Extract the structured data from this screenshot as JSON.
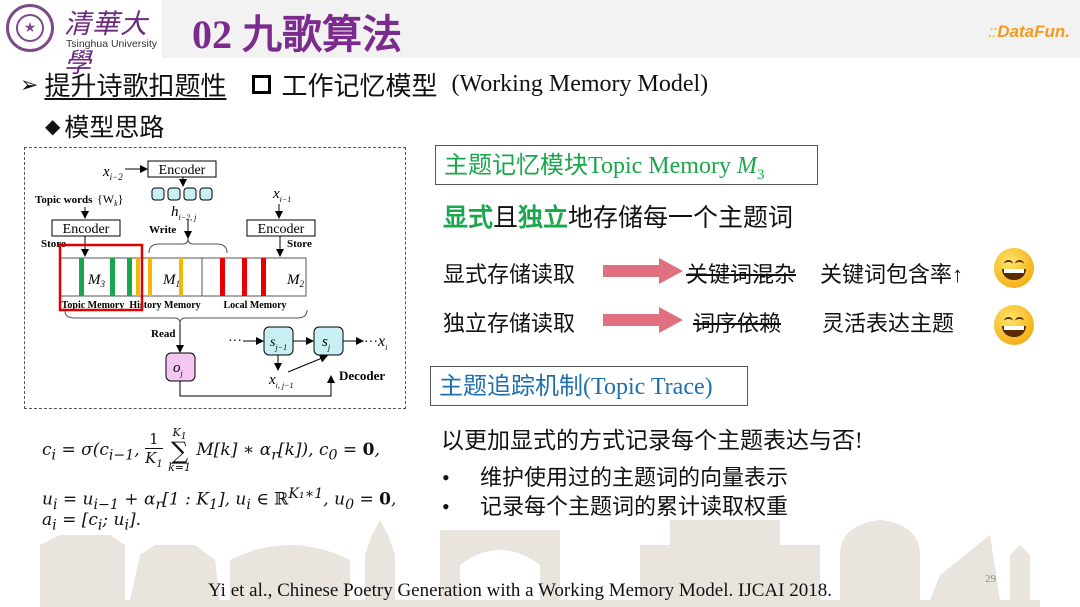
{
  "header": {
    "university_cn": "清華大學",
    "university_en": "Tsinghua University",
    "title": "02 九歌算法",
    "brand": "DataFun."
  },
  "bullets": {
    "level1_label": "提升诗歌扣题性",
    "level1_sub_cn": "工作记忆模型",
    "level1_sub_en": "(Working Memory Model)",
    "level2_label": "模型思路"
  },
  "diagram": {
    "x_i_minus_2": "x",
    "encoder_label": "Encoder",
    "topic_words_label": "Topic words",
    "topic_words_set": "{W",
    "topic_words_sub": "k",
    "h_label": "h",
    "h_sub": "i−2, j",
    "write_label": "Write",
    "store_label": "Store",
    "x_i_minus_1": "x",
    "read_label": "Read",
    "decoder_label": "Decoder",
    "memory_labels": [
      "Topic Memory",
      "History Memory",
      "Local Memory"
    ],
    "memory_symbols": [
      "M3",
      "M1",
      "M2"
    ],
    "o_label": "o",
    "s_prev_label": "s",
    "s_label": "s",
    "x_out_label": "x",
    "x_ij_label": "x",
    "ellipsis": "···"
  },
  "equations": [
    "cᵢ = σ(cᵢ₋₁, (1/K₁) Σₖ₌₁^{K₁} M[k] ∗ αᵣ[k]), c₀ = 0,",
    "uᵢ = uᵢ₋₁ + αᵣ[1 : K₁], uᵢ ∈ ℝ^{K₁∗1}, u₀ = 0,",
    "aᵢ = [cᵢ; uᵢ]."
  ],
  "topic_memory": {
    "title_cn": "主题记忆模块",
    "title_en": "Topic Memory ",
    "title_sym": "M",
    "title_sub": "3",
    "desc_g1": "显式",
    "desc_t1": "且",
    "desc_g2": "独立",
    "desc_t2": "地存储每一个主题词",
    "rows": [
      {
        "left": "显式存储读取",
        "struck": "关键词混杂",
        "result": "关键词包含率↑"
      },
      {
        "left": "独立存储读取",
        "struck": "词序依赖",
        "result": "灵活表达主题"
      }
    ],
    "arrow_color": "#e07080"
  },
  "topic_trace": {
    "title": "主题追踪机制(Topic Trace)",
    "desc": "以更加显式的方式记录每个主题表达与否!",
    "items": [
      "维护使用过的主题词的向量表示",
      "记录每个主题词的累计读取权重"
    ]
  },
  "footer": {
    "reference": "Yi et al., Chinese Poetry Generation with a Working Memory Model. IJCAI 2018.",
    "page": "29"
  },
  "colors": {
    "title": "#7b2a8e",
    "green": "#1aa64b",
    "blue": "#1e6fb0",
    "brand": "#f39a1e"
  }
}
